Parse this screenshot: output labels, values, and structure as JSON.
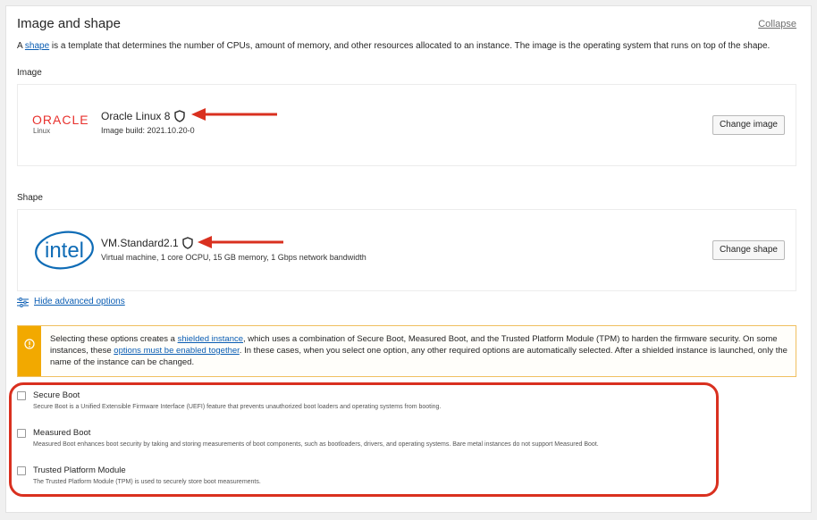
{
  "section": {
    "title": "Image and shape",
    "collapse_label": "Collapse",
    "intro_prefix": "A ",
    "intro_link": "shape",
    "intro_rest": " is a template that determines the number of CPUs, amount of memory, and other resources allocated to an instance. The image is the operating system that runs on top of the shape."
  },
  "image": {
    "label": "Image",
    "logo_brand": "ORACLE",
    "logo_sub": "Linux",
    "name": "Oracle Linux 8",
    "build": "Image build: 2021.10.20-0",
    "button_label": "Change image",
    "icon": "shield-icon"
  },
  "shape": {
    "label": "Shape",
    "logo_brand": "intel",
    "name": "VM.Standard2.1",
    "details": "Virtual machine, 1 core OCPU, 15 GB memory, 1 Gbps network bandwidth",
    "button_label": "Change shape",
    "icon": "shield-icon"
  },
  "advanced": {
    "label": "Hide advanced options",
    "icon": "sliders-icon"
  },
  "alert": {
    "icon": "warning-icon",
    "text_1": "Selecting these options creates a ",
    "link_1": "shielded instance",
    "text_2": ", which uses a combination of Secure Boot, Measured Boot, and the Trusted Platform Module (TPM) to harden the firmware security. On some instances, these ",
    "link_2": "options must be enabled together",
    "text_3": ". In these cases, when you select one option, any other required options are automatically selected. After a shielded instance is launched, only the name of the instance can be changed."
  },
  "options": [
    {
      "label": "Secure Boot",
      "description": "Secure Boot is a Unified Extensible Firmware Interface (UEFI) feature that prevents unauthorized boot loaders and operating systems from booting.",
      "checked": false
    },
    {
      "label": "Measured Boot",
      "description": "Measured Boot enhances boot security by taking and storing measurements of boot components, such as bootloaders, drivers, and operating systems. Bare metal instances do not support Measured Boot.",
      "checked": false
    },
    {
      "label": "Trusted Platform Module",
      "description": "The Trusted Platform Module (TPM) is used to securely store boot measurements.",
      "checked": false
    }
  ],
  "colors": {
    "link": "#0a5db3",
    "annotation_red": "#d9301f",
    "alert_yellow": "#f2a900",
    "oracle_red": "#e8312d",
    "intel_blue": "#0f6cb6"
  }
}
